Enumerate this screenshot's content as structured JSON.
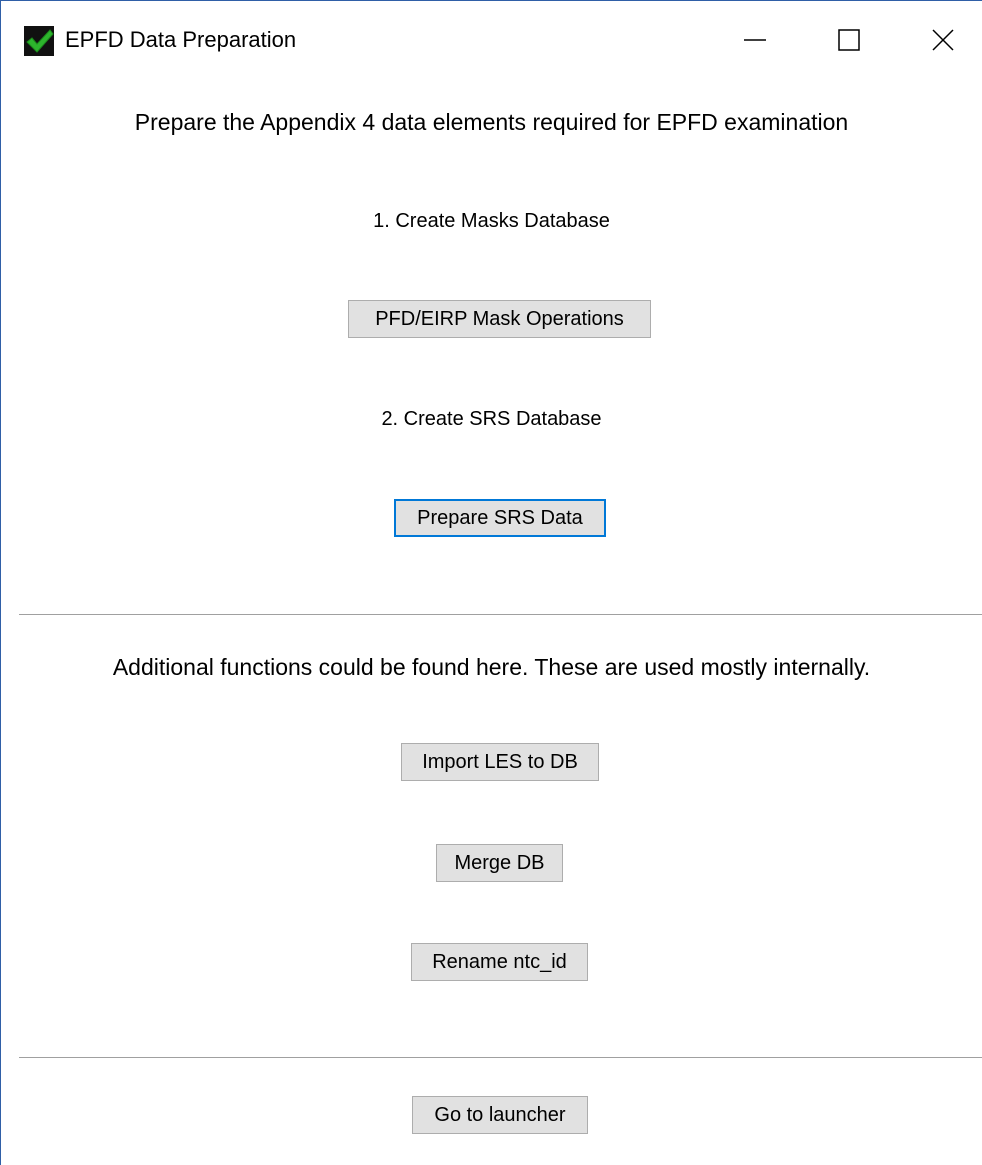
{
  "window": {
    "title": "EPFD Data Preparation",
    "icon": "green-checkmark-icon",
    "controls": [
      "minimize",
      "maximize",
      "close"
    ]
  },
  "main": {
    "heading": "Prepare the Appendix 4 data elements required for EPFD examination",
    "step1_label": "1. Create Masks Database",
    "step1_button": "PFD/EIRP Mask Operations",
    "step2_label": "2. Create SRS Database",
    "step2_button": "Prepare SRS Data"
  },
  "additional": {
    "heading": "Additional functions could be found here. These are used mostly internally.",
    "import_button": "Import LES to DB",
    "merge_button": "Merge DB",
    "rename_button": "Rename ntc_id"
  },
  "footer": {
    "launcher_button": "Go to launcher"
  },
  "colors": {
    "button_bg": "#e1e1e1",
    "button_border": "#adadad",
    "focus_border": "#0078d7",
    "divider": "#a0a0a0",
    "icon_green": "#2db52d"
  }
}
